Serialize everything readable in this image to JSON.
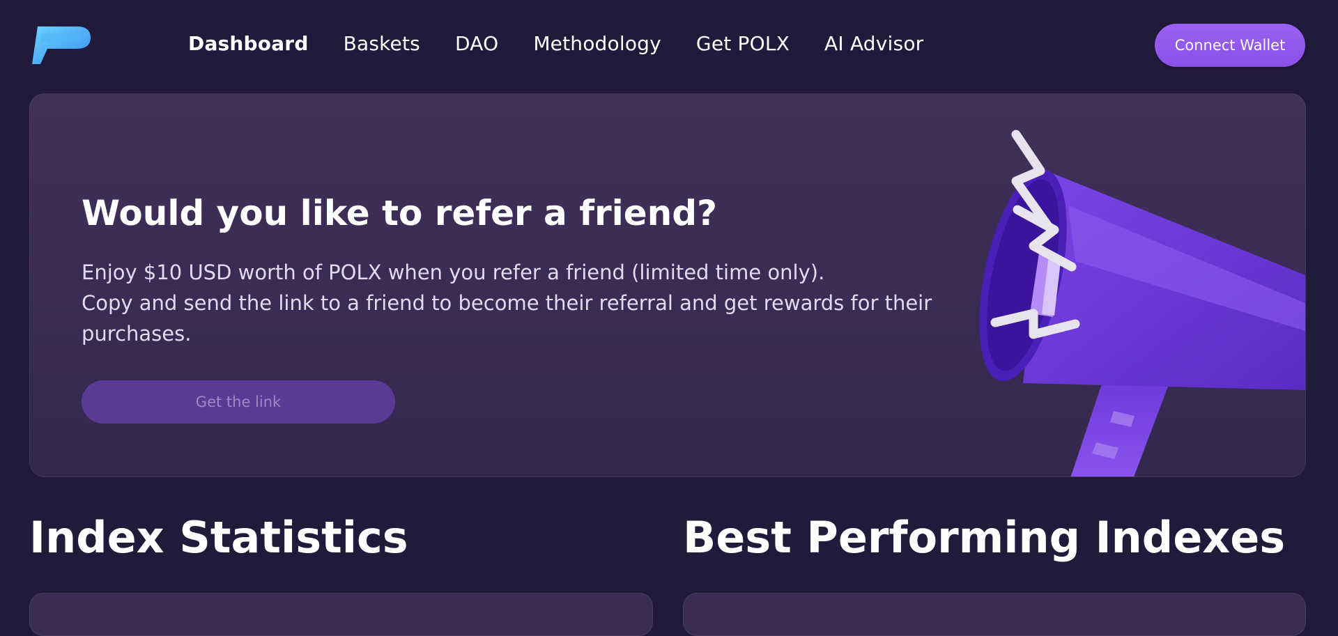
{
  "nav": {
    "items": [
      "Dashboard",
      "Baskets",
      "DAO",
      "Methodology",
      "Get POLX",
      "AI Advisor"
    ],
    "active": "Dashboard"
  },
  "header": {
    "connect_label": "Connect Wallet"
  },
  "hero": {
    "title": "Would you like to refer a friend?",
    "line1": "Enjoy $10 USD worth of POLX when you refer a friend (limited time only).",
    "line2": "Copy and send the link to a friend to become their referral and get rewards for their",
    "line3": "purchases.",
    "button_label": "Get the link"
  },
  "sections": {
    "index_statistics": "Index Statistics",
    "best_performing": "Best Performing Indexes"
  },
  "icons": {
    "logo": "polx-logo",
    "hero_art": "megaphone-icon"
  },
  "colors": {
    "background": "#221a3b",
    "accent": "#9b62f2",
    "card": "#3a2c55"
  }
}
